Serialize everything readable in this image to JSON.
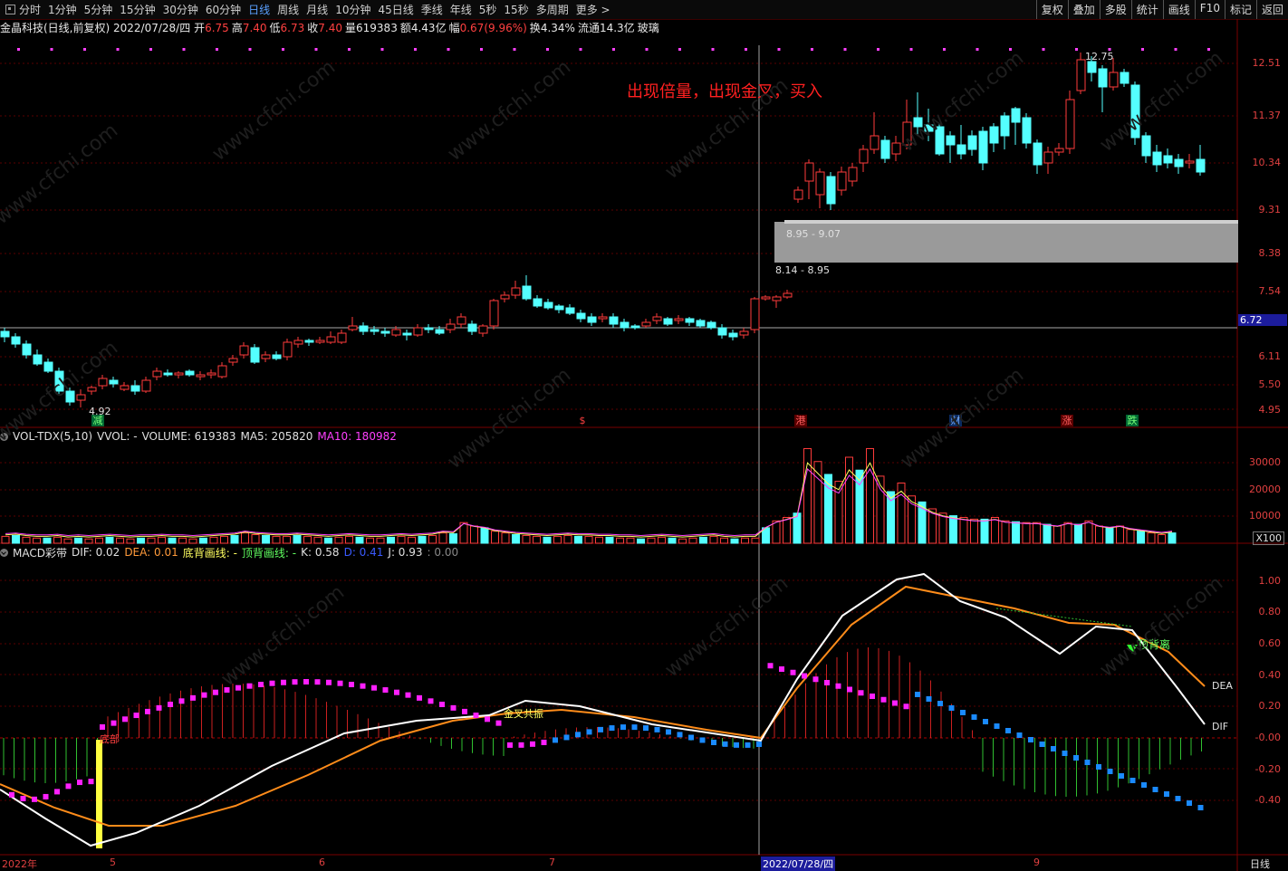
{
  "toolbar": {
    "periods": [
      "分时",
      "1分钟",
      "5分钟",
      "15分钟",
      "30分钟",
      "60分钟",
      "日线",
      "周线",
      "月线",
      "10分钟",
      "45日线",
      "季线",
      "年线",
      "5秒",
      "15秒",
      "多周期",
      "更多 >"
    ],
    "active_period": "日线",
    "right_buttons": [
      "复权",
      "叠加",
      "多股",
      "统计",
      "画线",
      "F10",
      "标记",
      "返回"
    ]
  },
  "stock": {
    "name": "金晶科技(日线,前复权)",
    "date": "2022/07/28/四",
    "open_label": "开",
    "open": "6.75",
    "high_label": "高",
    "high": "7.40",
    "low_label": "低",
    "low": "6.73",
    "close_label": "收",
    "close": "7.40",
    "volume_label": "量",
    "volume": "619383",
    "amount_label": "额",
    "amount": "4.43亿",
    "change_label": "幅",
    "change": "0.67(9.96%)",
    "turnover_label": "换",
    "turnover": "4.34%",
    "float_label": "流通",
    "float": "14.3亿",
    "sector": "玻璃"
  },
  "annotation": "出现倍量，出现金叉，买入",
  "price_axis": [
    "12.51",
    "11.37",
    "10.34",
    "9.31",
    "8.38",
    "7.54",
    "6.72",
    "6.11",
    "5.50",
    "4.95"
  ],
  "current_price_tag": "6.72",
  "chip_labels": [
    "8.95 - 9.07",
    "8.14 - 8.95"
  ],
  "price_marks": {
    "high_mark": "12.75",
    "low_mark": "4.92"
  },
  "events": [
    {
      "text": "减",
      "color": "#60ff60"
    },
    {
      "text": "$",
      "color": "#ff4040"
    },
    {
      "text": "港",
      "color": "#ff4040"
    },
    {
      "text": "财",
      "color": "#4090ff"
    },
    {
      "text": "涨",
      "color": "#ff4040"
    },
    {
      "text": "跌",
      "color": "#60ff60"
    }
  ],
  "volume_panel": {
    "name": "VOL-TDX(5,10)",
    "vvol": "VVOL: -",
    "volume": "VOLUME: 619383",
    "ma5": "MA5: 205820",
    "ma10": "MA10: 180982",
    "axis": [
      "30000",
      "20000",
      "10000"
    ],
    "unit": "X100"
  },
  "macd_panel": {
    "name": "MACD彩带",
    "dif": "DIF: 0.02",
    "dea": "DEA: 0.01",
    "bottom_div": "底背画线: -",
    "top_div": "顶背画线: -",
    "k": "K: 0.58",
    "d": "D: 0.41",
    "j": "J: 0.93",
    "extra": ": 0.00",
    "axis": [
      "1.00",
      "0.80",
      "0.60",
      "0.40",
      "0.20",
      "-0.00",
      "-0.20",
      "-0.40"
    ],
    "dea_label": "DEA",
    "dif_label": "DIF",
    "bottom_label": "底部",
    "resonance_label": "金叉共振",
    "top_div_label": "顶背离"
  },
  "date_axis": [
    "2022年",
    "5",
    "6",
    "7",
    "2022/07/28/四",
    "9"
  ],
  "period_tag": "日线",
  "watermark": "www.cfchi.com",
  "colors": {
    "up": "#ff3b3b",
    "down": "#54ffff",
    "ma_white": "#ffffff",
    "ma_yellow": "#ffff60",
    "ma_magenta": "#ff40ff",
    "dea": "#ff8c1a",
    "grid": "#5a0000"
  }
}
